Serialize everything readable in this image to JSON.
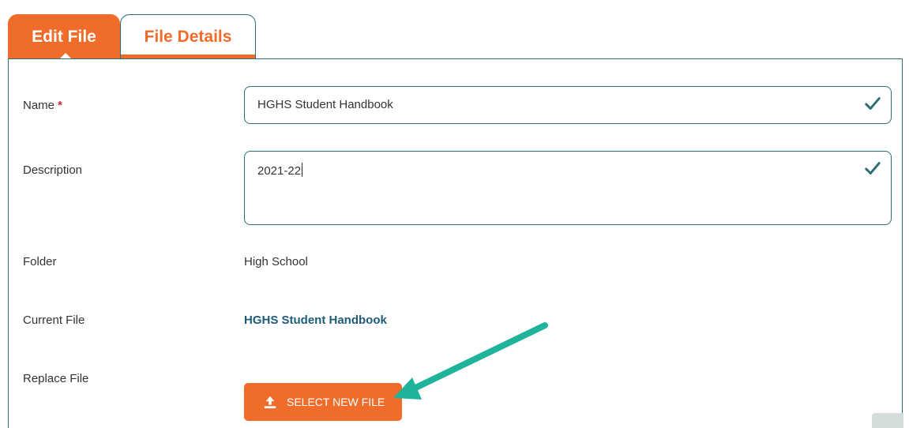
{
  "tabs": [
    {
      "label": "Edit File",
      "active": true
    },
    {
      "label": "File Details",
      "active": false
    }
  ],
  "form": {
    "name_label": "Name",
    "required_marker": "*",
    "name_value": "HGHS Student Handbook",
    "description_label": "Description",
    "description_value": "2021-22",
    "folder_label": "Folder",
    "folder_value": "High School",
    "current_file_label": "Current File",
    "current_file_value": "HGHS Student Handbook",
    "replace_file_label": "Replace File",
    "select_button_label": "SELECT NEW FILE"
  },
  "icons": {
    "valid": "checkmark-icon",
    "upload": "upload-icon"
  },
  "colors": {
    "accent": "#ef6c2a",
    "border": "#2c6e74",
    "link": "#1f5c78",
    "required": "#d0283b",
    "annotation_arrow": "#1fb39a"
  }
}
